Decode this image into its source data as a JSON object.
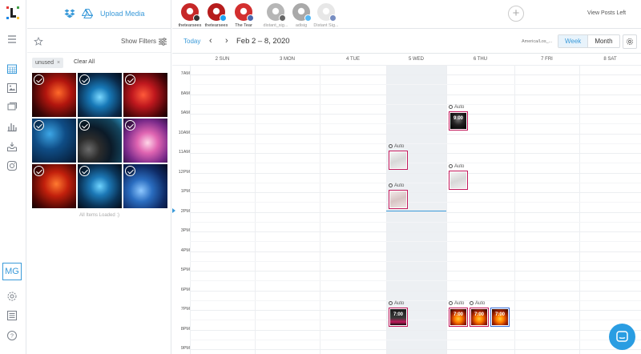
{
  "media": {
    "upload_label": "Upload Media",
    "show_filters": "Show Filters",
    "active_tag": "unused",
    "clear_all": "Clear All",
    "all_loaded": "All Items Loaded :)"
  },
  "user": {
    "initials": "MG"
  },
  "profiles": [
    {
      "name": "thetearsees",
      "network": "instagram",
      "avatar_color": "#c62828",
      "dim": false
    },
    {
      "name": "thetearsees",
      "network": "twitter",
      "avatar_color": "#b71c1c",
      "dim": false
    },
    {
      "name": "The Tear",
      "network": "facebook",
      "avatar_color": "#d32f2f",
      "dim": false
    },
    {
      "name": "distant_sig...",
      "network": "instagram",
      "avatar_color": "#9e9e9e",
      "dim": true
    },
    {
      "name": "adisig",
      "network": "twitter",
      "avatar_color": "#8d8d8d",
      "dim": true
    },
    {
      "name": "Distant Sig...",
      "network": "facebook",
      "avatar_color": "#e0e0e0",
      "dim": true
    }
  ],
  "view_posts_left": "View Posts Left",
  "calendar": {
    "today_label": "Today",
    "range": "Feb 2 – 8, 2020",
    "timezone": "America/Los_...",
    "view_week": "Week",
    "view_month": "Month",
    "days": [
      "2 SUN",
      "3 MON",
      "4 TUE",
      "5 WED",
      "6 THU",
      "7 FRI",
      "8 SAT"
    ],
    "hours": [
      "7AM",
      "8AM",
      "9AM",
      "10AM",
      "11AM",
      "12PM",
      "1PM",
      "2PM",
      "3PM",
      "4PM",
      "5PM",
      "6PM",
      "7PM",
      "8PM",
      "9PM"
    ],
    "auto_label": "Auto",
    "posts": [
      {
        "day": 4,
        "time": "9:00",
        "show_time": true,
        "image": "dark-portrait"
      },
      {
        "day": 3,
        "time": "11:00",
        "show_time": false,
        "image": "light-sketch"
      },
      {
        "day": 4,
        "time": "12:00",
        "show_time": false,
        "image": "light-sketch"
      },
      {
        "day": 3,
        "time": "1:00",
        "show_time": false,
        "image": "light-photo"
      },
      {
        "day": 3,
        "time": "7:00",
        "show_time": true,
        "image": "dark-promo"
      },
      {
        "day": 4,
        "time": "7:00",
        "show_time": true,
        "image": "fire"
      },
      {
        "day": 4,
        "time": "7:00",
        "show_time": true,
        "image": "fire"
      },
      {
        "day": 4,
        "time": "7:00",
        "show_time": true,
        "image": "fire"
      }
    ]
  },
  "colors": {
    "accent": "#3a9ad9",
    "post_border": "#c2185b",
    "post_border_alt": "#3a6fd9"
  }
}
